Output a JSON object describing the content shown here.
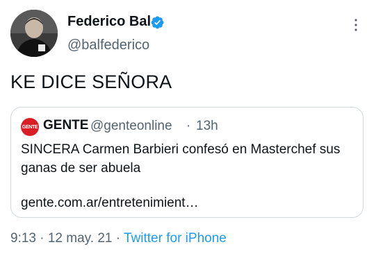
{
  "tweet": {
    "author": {
      "display_name": "Federico Bal",
      "handle": "@balfederico",
      "verified": true,
      "avatar_icon": "profile-photo"
    },
    "text": "KE DICE SEÑORA",
    "quoted_tweet": {
      "avatar_label": "GENTE",
      "display_name": "GENTE",
      "handle": "@genteonline",
      "separator": "·",
      "time": "13h",
      "text": "SINCERA Carmen Barbieri confesó en Masterchef sus ganas de ser abuela",
      "link": "gente.com.ar/entretenimient…"
    },
    "timestamp": "9:13 · 12 may. 21",
    "meta_separator": " · ",
    "source": "Twitter for iPhone"
  },
  "colors": {
    "text_primary": "#0f1419",
    "text_secondary": "#536471",
    "accent": "#1d9bf0",
    "border": "#cfd9de",
    "gente_brand": "#d81f26"
  },
  "icons": {
    "verified": "verified-badge-icon",
    "more": "more-options-icon"
  }
}
